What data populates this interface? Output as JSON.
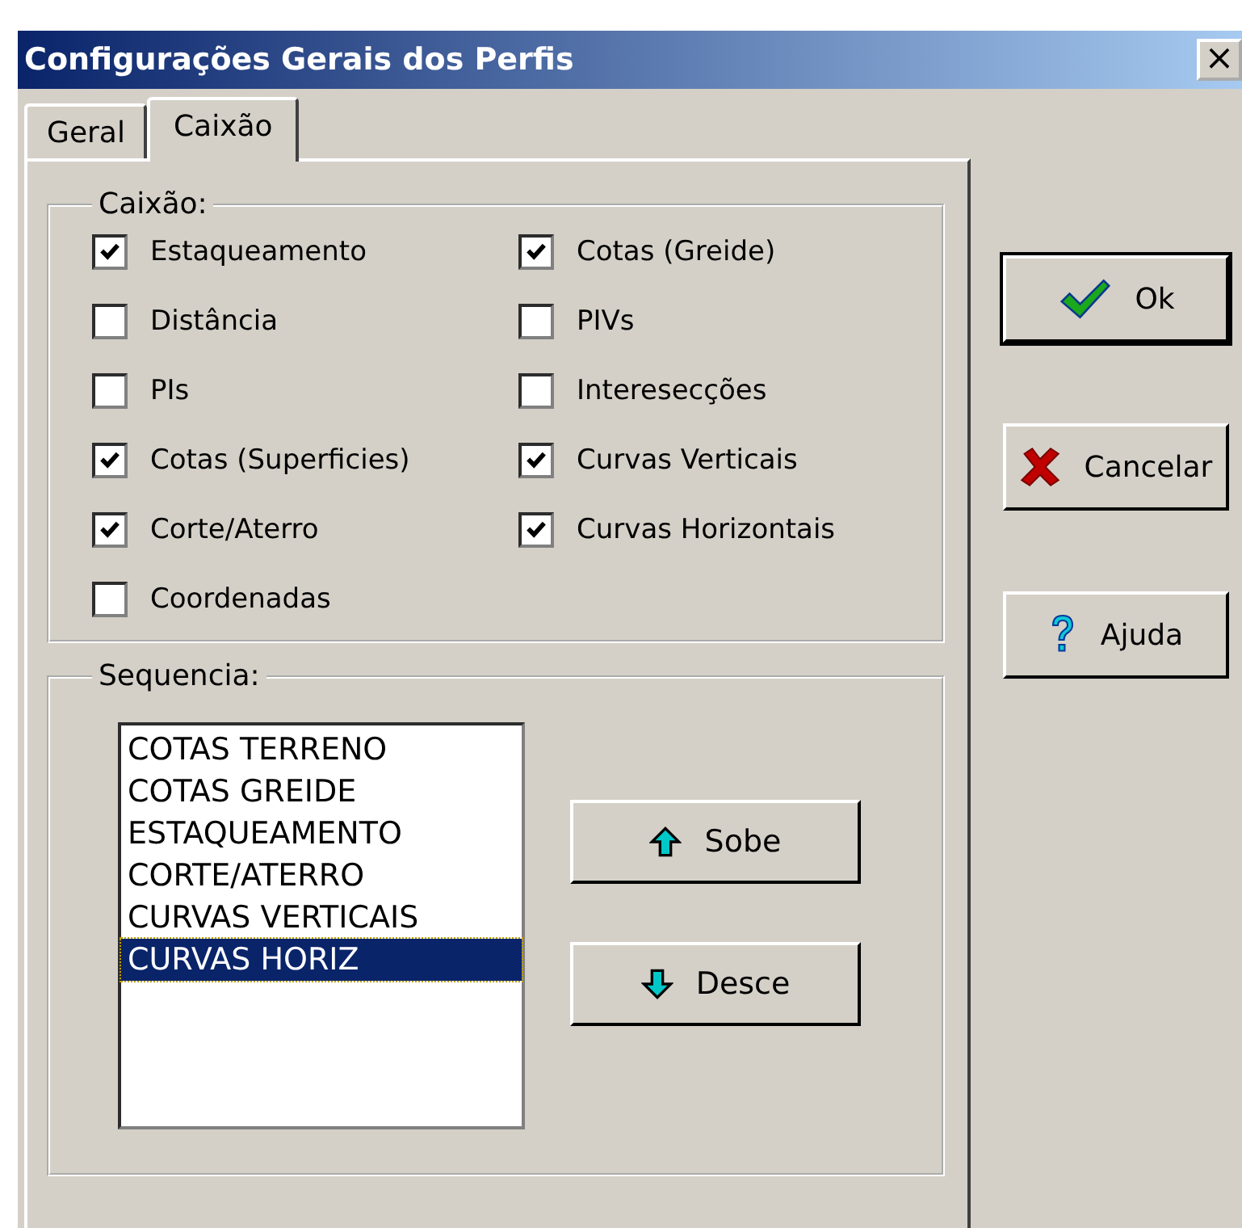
{
  "window": {
    "title": "Configurações Gerais dos Perfis",
    "close": "×"
  },
  "tabs": [
    {
      "label": "Geral",
      "selected": false
    },
    {
      "label": "Caixão",
      "selected": true
    }
  ],
  "caixao": {
    "legend": "Caixão:",
    "columns": [
      [
        {
          "label": "Estaqueamento",
          "checked": true
        },
        {
          "label": "Distância",
          "checked": false
        },
        {
          "label": "PIs",
          "checked": false
        },
        {
          "label": "Cotas (Superficies)",
          "checked": true
        },
        {
          "label": "Corte/Aterro",
          "checked": true
        },
        {
          "label": "Coordenadas",
          "checked": false
        }
      ],
      [
        {
          "label": "Cotas (Greide)",
          "checked": true
        },
        {
          "label": "PIVs",
          "checked": false
        },
        {
          "label": "Interesecções",
          "checked": false
        },
        {
          "label": "Curvas Verticais",
          "checked": true
        },
        {
          "label": "Curvas Horizontais",
          "checked": true
        }
      ]
    ]
  },
  "sequencia": {
    "legend": "Sequencia:",
    "items": [
      {
        "label": "COTAS TERRENO",
        "selected": false
      },
      {
        "label": "COTAS GREIDE",
        "selected": false
      },
      {
        "label": "ESTAQUEAMENTO",
        "selected": false
      },
      {
        "label": "CORTE/ATERRO",
        "selected": false
      },
      {
        "label": "CURVAS VERTICAIS",
        "selected": false
      },
      {
        "label": "CURVAS HORIZ",
        "selected": true
      }
    ],
    "buttons": [
      {
        "label": "Sobe",
        "kind": "up"
      },
      {
        "label": "Desce",
        "kind": "down"
      }
    ]
  },
  "buttons": [
    {
      "label": "Ok",
      "kind": "ok",
      "default": true
    },
    {
      "label": "Cancelar",
      "kind": "cancel",
      "default": false
    },
    {
      "label": "Ajuda",
      "kind": "help",
      "default": false
    }
  ]
}
